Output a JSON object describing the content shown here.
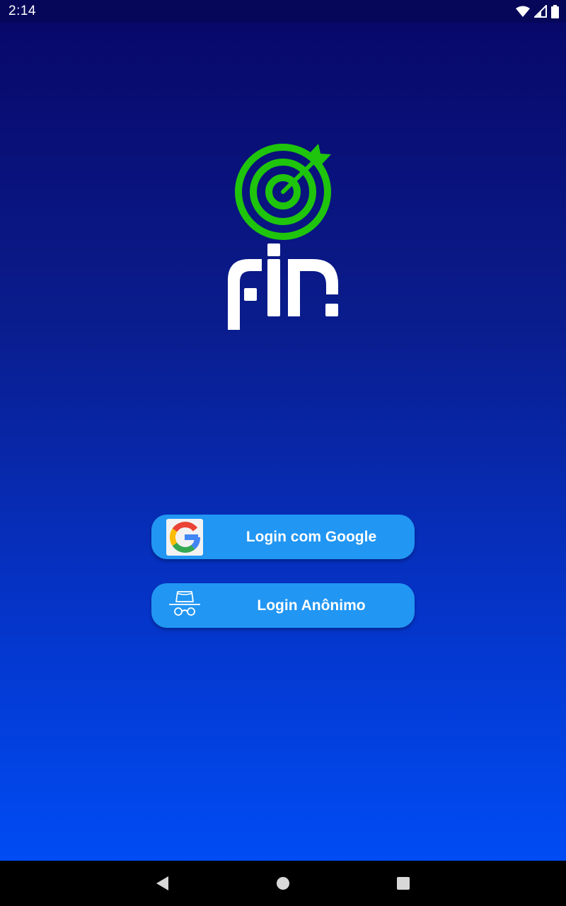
{
  "status_bar": {
    "time": "2:14",
    "icons": [
      "wifi-icon",
      "signal-icon",
      "battery-icon"
    ]
  },
  "logo": {
    "wordmark": "fin",
    "target_color": "#1fc40c",
    "wordmark_color": "#ffffff"
  },
  "buttons": {
    "google_label": "Login com Google",
    "anonymous_label": "Login Anônimo",
    "button_color": "#2196f3"
  },
  "navigation": {
    "icons": [
      "back-icon",
      "home-icon",
      "recents-icon"
    ]
  },
  "colors": {
    "status_bar": "#07075a",
    "background_top": "#08086a",
    "background_bottom": "#004cf4"
  }
}
